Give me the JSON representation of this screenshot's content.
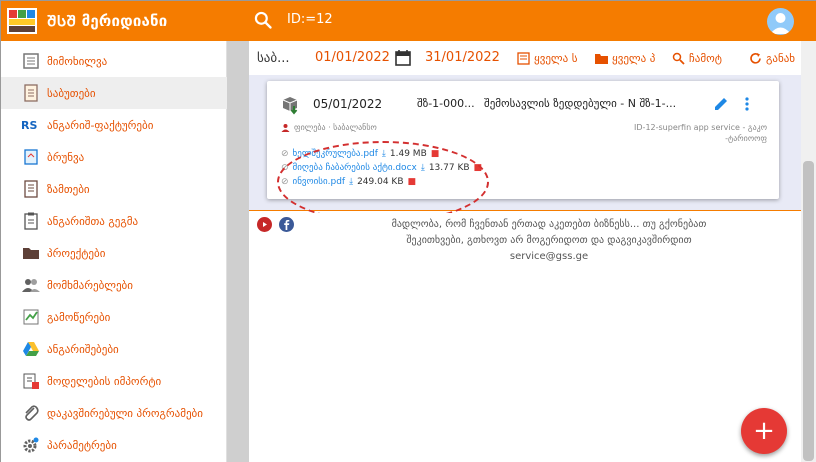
{
  "app": {
    "title": "ᲨᲡᲨ მერიდიანი",
    "search_text": "ID:=12"
  },
  "colors": {
    "accent": "#f57c00",
    "link": "#1e88e5",
    "danger": "#e53935",
    "results_bg": "#e8eaf6"
  },
  "sidebar": {
    "items": [
      {
        "label": "მიმოხილვა",
        "icon": "overview-icon"
      },
      {
        "label": "საბუთები",
        "icon": "documents-icon",
        "active": true
      },
      {
        "label": "ანგარიშ-ფაქტურები",
        "prefix": "RS",
        "icon": "rs-icon"
      },
      {
        "label": "ბრუნვა",
        "icon": "turnover-icon"
      },
      {
        "label": "ზამთები",
        "icon": "reports-icon"
      },
      {
        "label": "ანგარიშთა გეგმა",
        "icon": "chart-of-accounts-icon"
      },
      {
        "label": "პროექტები",
        "icon": "folder-icon"
      },
      {
        "label": "მომხმარებლები",
        "icon": "users-icon"
      },
      {
        "label": "გამოწერები",
        "icon": "subscriptions-icon"
      },
      {
        "label": "ანგარიშებები",
        "icon": "drive-icon"
      },
      {
        "label": "მოდელების იმპორტი",
        "icon": "import-icon"
      },
      {
        "label": "დაკავშირებული პროგრამები",
        "icon": "paperclip-icon"
      },
      {
        "label": "პარამეტრები",
        "icon": "settings-icon"
      }
    ]
  },
  "toolbar": {
    "title": "საბ...",
    "date_from": "01/01/2022",
    "date_to": "31/01/2022",
    "btn_all_docs": "ყველა ს",
    "btn_all_folders": "ყველა პ",
    "btn_search": "ჩამოტ",
    "btn_refresh": "განახ"
  },
  "card": {
    "date": "05/01/2022",
    "number": "შზ-1-000...",
    "title": "შემოსავლის ზედდებული - N შზ-1-...",
    "meta_left": "ფილება · საბალანსო",
    "meta_right": "ID-12-superfin app service - გაკო -ტარიოოფ",
    "attachments": [
      {
        "name": "ხელშეკრულება.pdf",
        "size": "1.49 MB"
      },
      {
        "name": "მიღება ჩაბარების აქტი.docx",
        "size": "13.77 KB"
      },
      {
        "name": "ინვოისი.pdf",
        "size": "249.04 KB"
      }
    ]
  },
  "footer": {
    "line1": "მადლობა, რომ ჩვენთან ერთად აკეთებთ ბიზნესს... თუ გქონებათ",
    "line2": "შეკითხვები, გთხოვთ არ მოგერიდოთ და დაგვიკავშირდით",
    "email": "service@gss.ge"
  },
  "fab": {
    "label": "+"
  }
}
